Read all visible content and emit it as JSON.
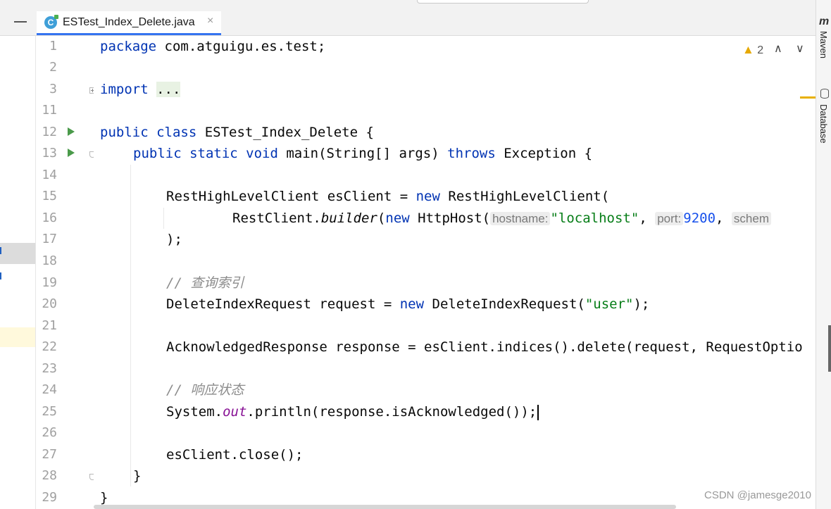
{
  "tab": {
    "title": "ESTest_Index_Delete.java",
    "icon_letter": "C",
    "close": "×"
  },
  "inspections": {
    "warning_count": "2",
    "up": "∧",
    "down": "∨"
  },
  "right_panel": {
    "maven": "Maven",
    "database": "Database",
    "maven_icon": "m"
  },
  "watermark": "CSDN @jamesge2010",
  "lines": [
    {
      "n": "1",
      "t1": "package",
      "t2": " com.atguigu.es.test;"
    },
    {
      "n": "2"
    },
    {
      "n": "3",
      "t1": "import",
      "t2": "..."
    },
    {
      "n": "11"
    },
    {
      "n": "12",
      "t1": "public class",
      "t2": " ESTest_Index_Delete {"
    },
    {
      "n": "13",
      "t1": "public static void",
      "t2": " main(String[] args) ",
      "t3": "throws",
      "t4": " Exception {"
    },
    {
      "n": "14"
    },
    {
      "n": "15",
      "t1": "RestHighLevelClient esClient = ",
      "t2": "new",
      "t3": " RestHighLevelClient("
    },
    {
      "n": "16",
      "t1": "RestClient.",
      "t2": "builder",
      "t3": "(",
      "t4": "new",
      "t5": " HttpHost(",
      "h1": "hostname:",
      "s1": "\"localhost\"",
      "t6": ", ",
      "h2": "port:",
      "n1": "9200",
      "t7": ", ",
      "h3": "schem"
    },
    {
      "n": "17",
      "t1": ");"
    },
    {
      "n": "18"
    },
    {
      "n": "19",
      "c": "// 查询索引"
    },
    {
      "n": "20",
      "t1": "DeleteIndexRequest request = ",
      "t2": "new",
      "t3": " DeleteIndexRequest(",
      "s1": "\"user\"",
      "t4": ");"
    },
    {
      "n": "21"
    },
    {
      "n": "22",
      "t1": "AcknowledgedResponse response = esClient.indices().delete(request, RequestOptio"
    },
    {
      "n": "23"
    },
    {
      "n": "24",
      "c": "// 响应状态"
    },
    {
      "n": "25",
      "t1": "System.",
      "f1": "out",
      "t2": ".println(response.isAcknowledged());"
    },
    {
      "n": "26"
    },
    {
      "n": "27",
      "t1": "esClient.close();"
    },
    {
      "n": "28",
      "t1": "}"
    },
    {
      "n": "29",
      "t1": "}"
    }
  ]
}
